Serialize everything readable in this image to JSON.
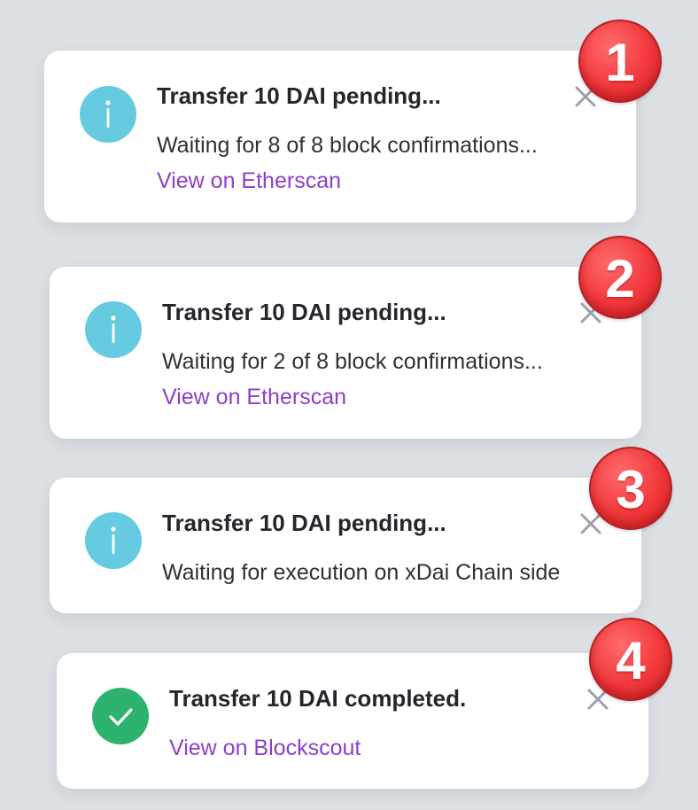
{
  "colors": {
    "background": "#dcdfe3",
    "info": "#66cbe0",
    "success": "#2eb36e",
    "link": "#8e3fc9",
    "badge": "#f2373b"
  },
  "notifications": [
    {
      "badge": "1",
      "status": "info-icon",
      "title": "Transfer 10 DAI pending...",
      "message": "Waiting for 8 of 8 block confirmations...",
      "link": "View on Etherscan"
    },
    {
      "badge": "2",
      "status": "info-icon",
      "title": "Transfer 10 DAI pending...",
      "message": "Waiting for 2 of 8 block confirmations...",
      "link": "View on Etherscan"
    },
    {
      "badge": "3",
      "status": "info-icon",
      "title": "Transfer 10 DAI pending...",
      "message": "Waiting for execution on xDai Chain side"
    },
    {
      "badge": "4",
      "status": "check-icon",
      "title": "Transfer 10 DAI completed.",
      "link": "View on Blockscout"
    }
  ]
}
